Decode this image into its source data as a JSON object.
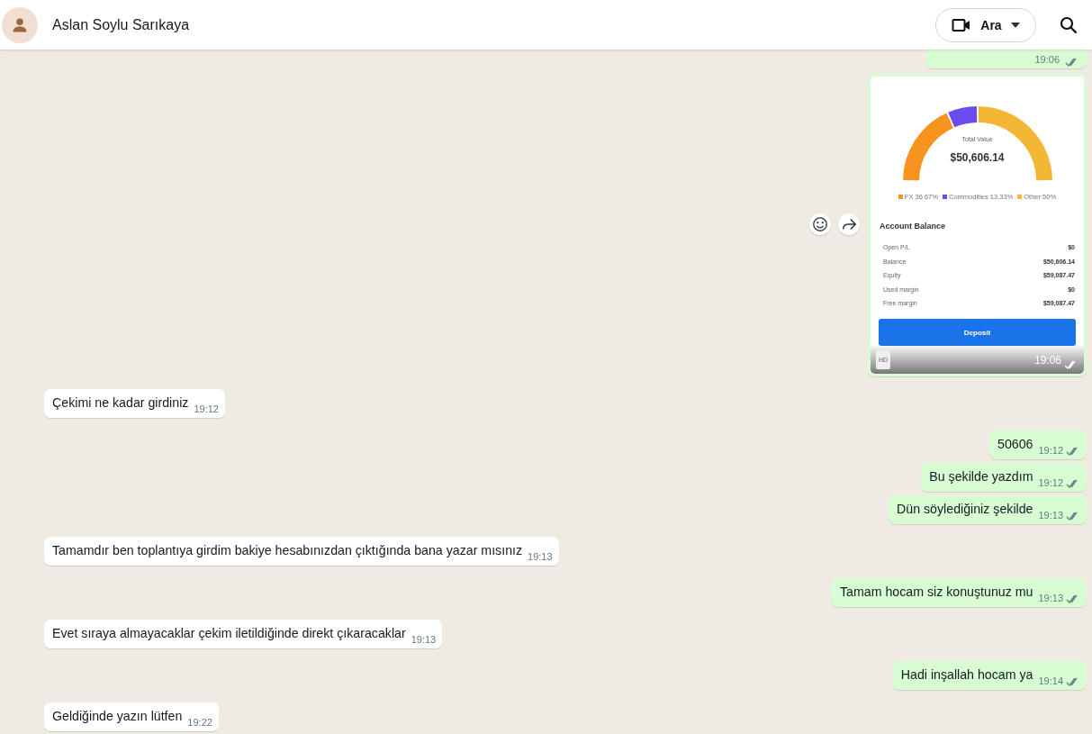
{
  "header": {
    "contact_name": "Aslan Soylu Sarıkaya",
    "call_button": {
      "label": "Ara"
    }
  },
  "messages": [
    {
      "kind": "partial",
      "outgoing": true,
      "time": "19:06"
    },
    {
      "kind": "image",
      "outgoing": true,
      "time": "19:06",
      "badge": "HD",
      "screenshot": {
        "center_label": "Total Value",
        "center_value": "$50,606.14",
        "legend": [
          {
            "label": "FX 36.67%",
            "color": "#f7931e"
          },
          {
            "label": "Commodities 13.33%",
            "color": "#6a4cf0"
          },
          {
            "label": "Other 50%",
            "color": "#f3b735"
          }
        ],
        "section_title": "Account Balance",
        "rows": [
          {
            "label": "Open P/L",
            "value": "$0"
          },
          {
            "label": "Balance",
            "value": "$50,606.14"
          },
          {
            "label": "Equity",
            "value": "$59,087.47"
          },
          {
            "label": "Used margin",
            "value": "$0"
          },
          {
            "label": "Free margin",
            "value": "$59,087.47"
          }
        ],
        "button": "Deposit"
      }
    },
    {
      "kind": "text",
      "outgoing": false,
      "text": "Çekimi ne kadar girdiniz",
      "time": "19:12"
    },
    {
      "kind": "text",
      "outgoing": true,
      "text": "50606",
      "time": "19:12"
    },
    {
      "kind": "text",
      "outgoing": true,
      "text": "Bu şekilde yazdım",
      "time": "19:12"
    },
    {
      "kind": "text",
      "outgoing": true,
      "text": "Dün söylediğiniz şekilde",
      "time": "19:13"
    },
    {
      "kind": "text",
      "outgoing": false,
      "text": "Tamamdır ben toplantıya girdim bakiye hesabınızdan çıktığında bana yazar mısınız",
      "time": "19:13"
    },
    {
      "kind": "text",
      "outgoing": true,
      "text": "Tamam hocam siz konuştunuz mu",
      "time": "19:13"
    },
    {
      "kind": "text",
      "outgoing": false,
      "text": "Evet sıraya almayacaklar çekim iletildiğinde direkt çıkaracaklar",
      "time": "19:13"
    },
    {
      "kind": "text",
      "outgoing": true,
      "text": "Hadi inşallah hocam ya",
      "time": "19:14"
    },
    {
      "kind": "text",
      "outgoing": false,
      "text": "Geldiğinde yazın lütfen",
      "time": "19:22"
    }
  ]
}
